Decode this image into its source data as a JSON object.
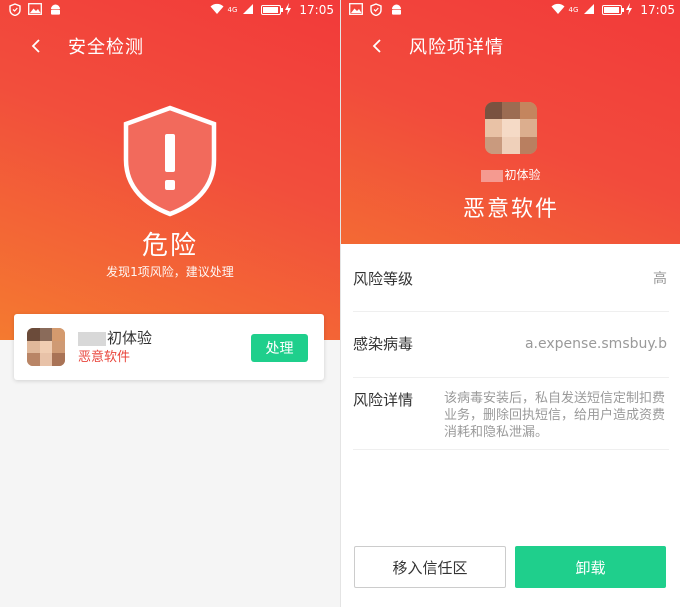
{
  "status_bar": {
    "time": "17:05",
    "network": "4G",
    "icons": [
      "shield-icon",
      "image-icon",
      "android-icon",
      "wifi-icon",
      "signal-icon",
      "battery-icon",
      "charging-icon"
    ]
  },
  "left_screen": {
    "title": "安全检测",
    "status_title": "危险",
    "status_subtitle": "发现1项风险，建议处理",
    "colors": {
      "accent_red": "#f23a3a",
      "gradient_orange": "#f47a30",
      "action_green": "#1fcf8c",
      "danger_text": "#e8453c"
    },
    "risk_item": {
      "app_name": "初体验",
      "risk_type": "恶意软件",
      "action_label": "处理"
    }
  },
  "right_screen": {
    "title": "风险项详情",
    "app_name": "初体验",
    "risk_type": "恶意软件",
    "rows": [
      {
        "label": "风险等级",
        "value": "高"
      },
      {
        "label": "感染病毒",
        "value": "a.expense.smsbuy.b"
      },
      {
        "label": "风险详情",
        "value": "该病毒安装后，私自发送短信定制扣费业务，删除回执短信，给用户造成资费消耗和隐私泄漏。"
      }
    ],
    "trust_button": "移入信任区",
    "uninstall_button": "卸载"
  }
}
